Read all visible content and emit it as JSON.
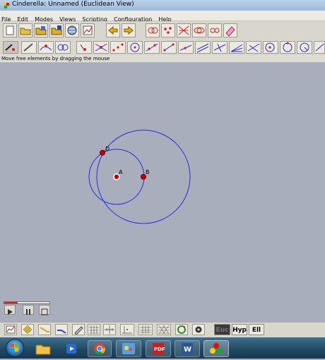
{
  "window": {
    "title": "Cinderella: Unnamed (Euclidean View)"
  },
  "menu": [
    "File",
    "Edit",
    "Modes",
    "Views",
    "Scripting",
    "Configuration",
    "Help"
  ],
  "status": "Move free elements by dragging the mouse",
  "points": {
    "a": "A",
    "b": "B",
    "d": "D"
  },
  "geometry_buttons": {
    "euc": "Euc",
    "hyp": "Hyp",
    "ell": "Ell"
  },
  "colors": {
    "circle": "#2c2cd8",
    "point": "#c80000",
    "canvas": "#a8aebc",
    "selected_geom": "#3a3a3a"
  }
}
